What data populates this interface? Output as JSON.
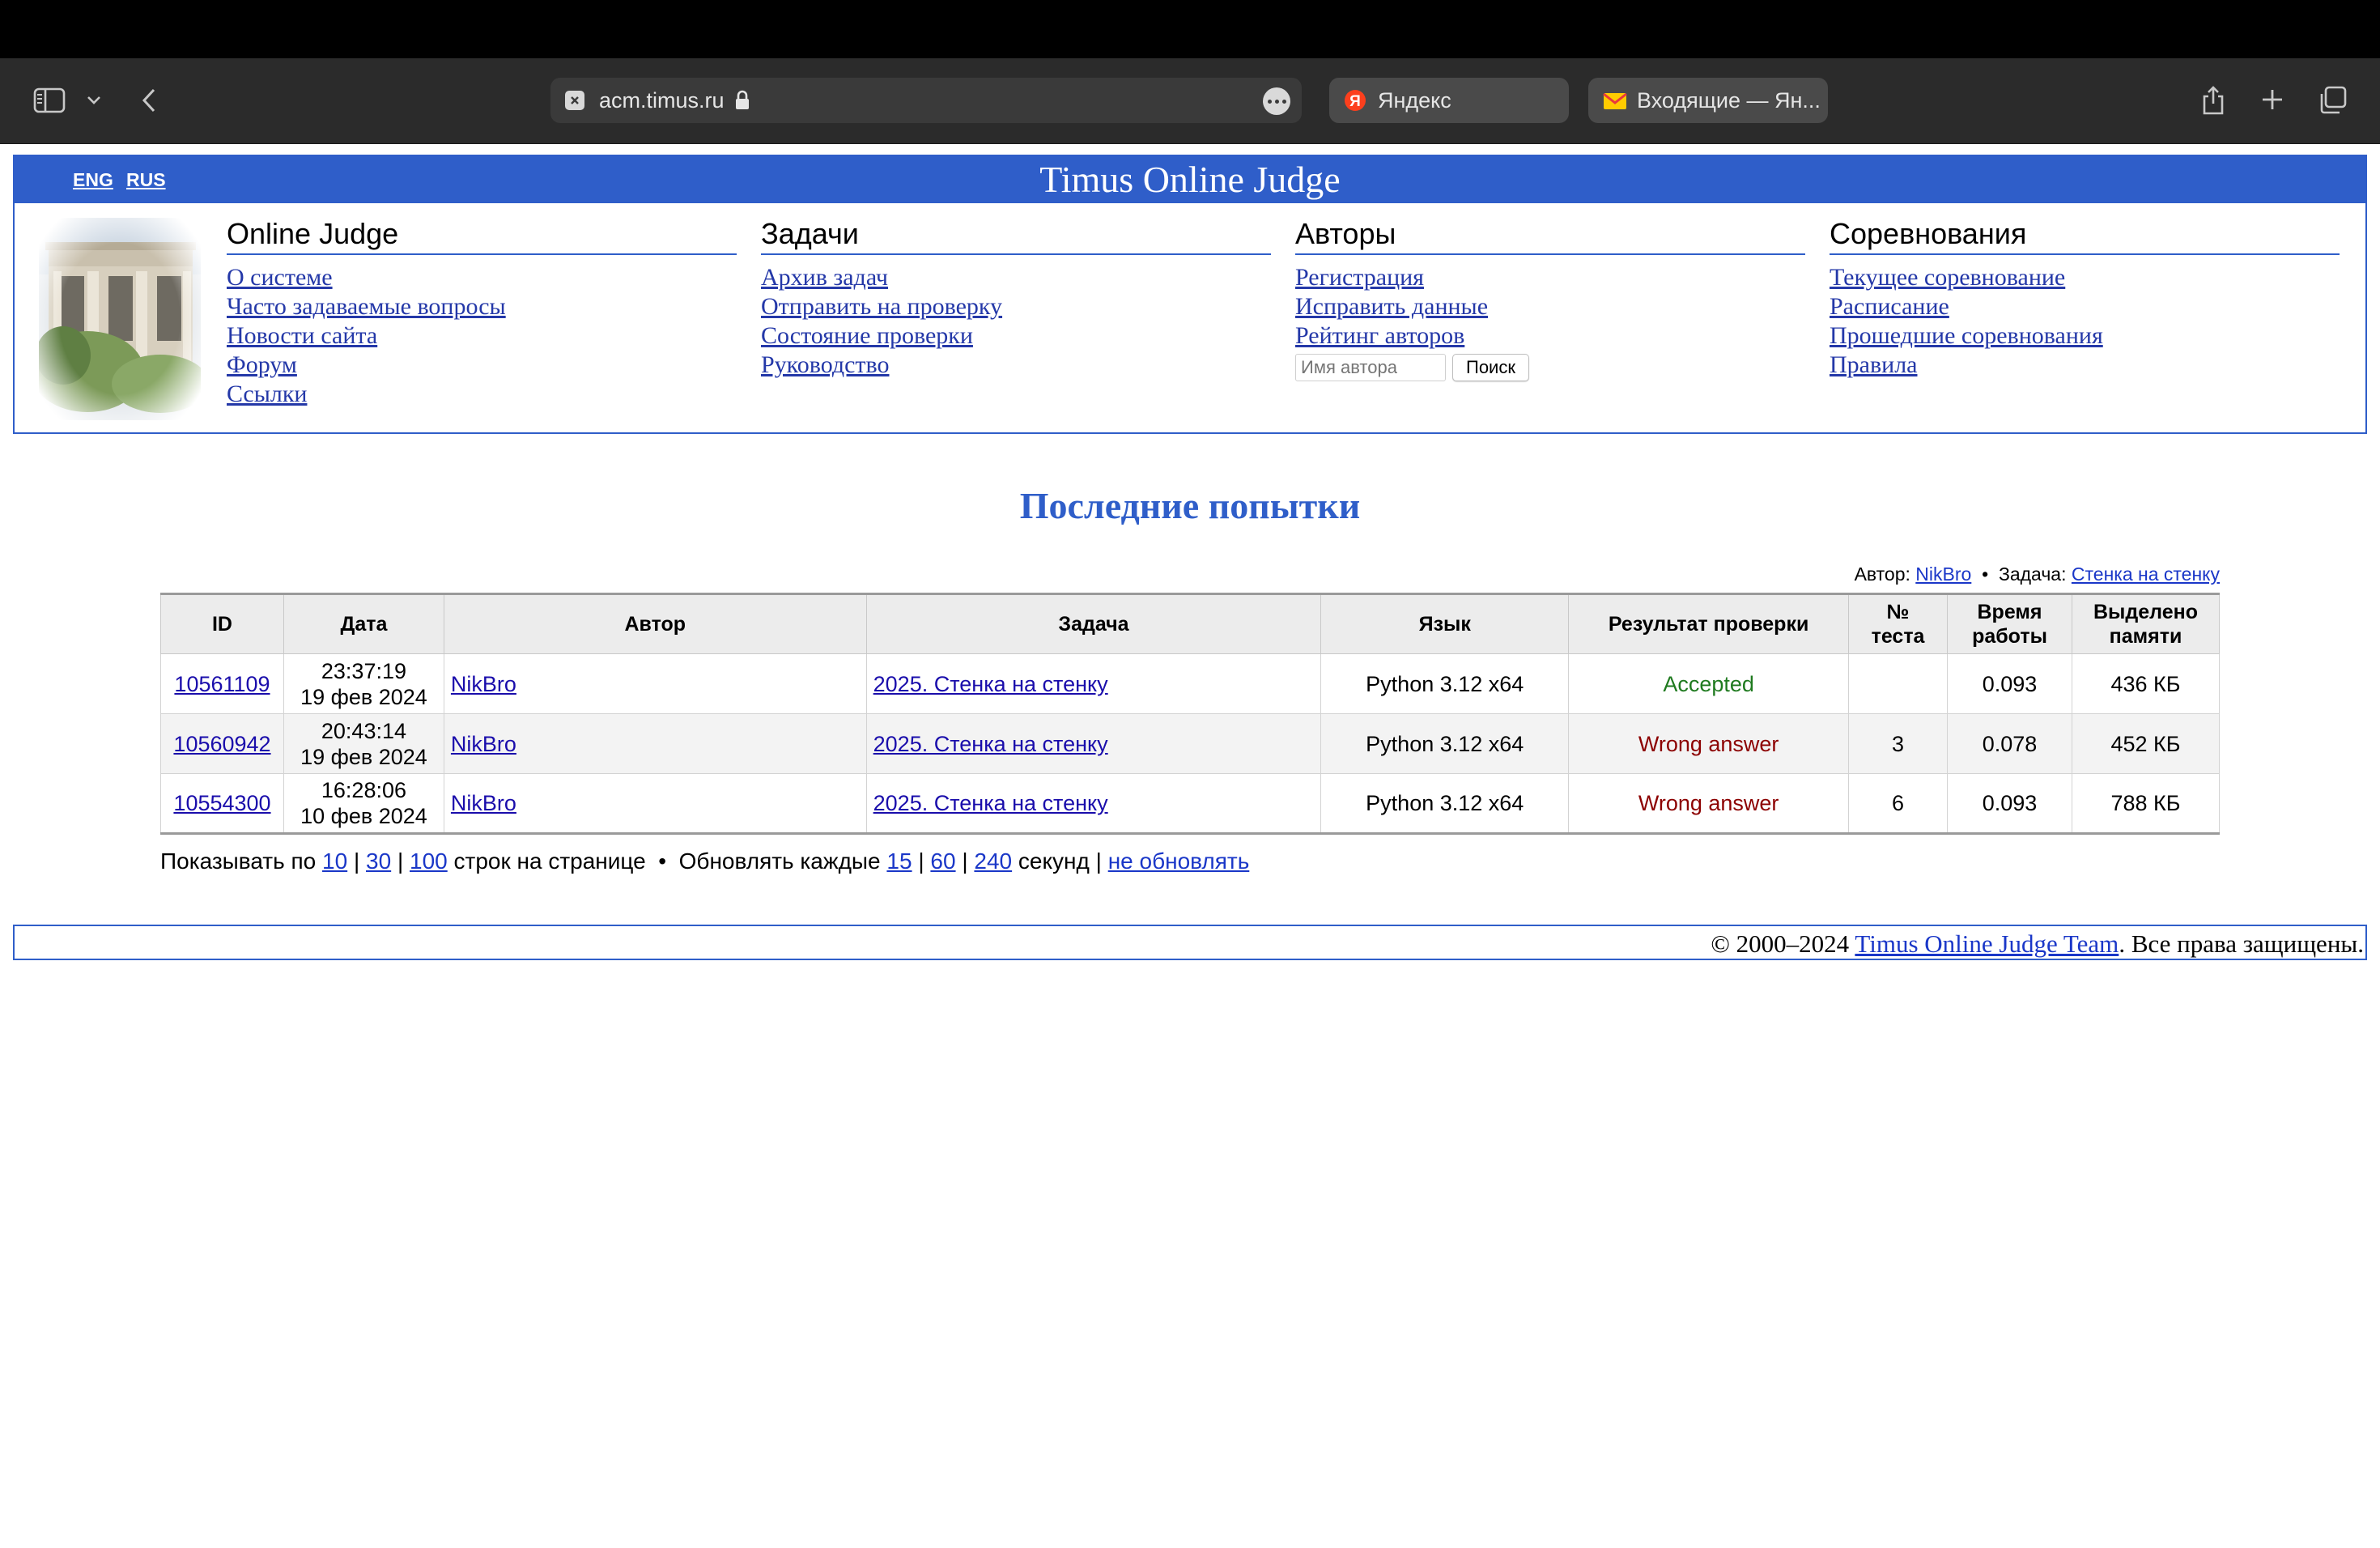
{
  "browser": {
    "url": "acm.timus.ru",
    "tabs": [
      {
        "title": "Яндекс",
        "icon": "yandex-icon"
      },
      {
        "title": "Входящие — Ян...",
        "icon": "mail-icon"
      }
    ]
  },
  "header": {
    "lang_eng": "ENG",
    "lang_rus": "RUS",
    "site_title": "Timus Online Judge"
  },
  "menu": {
    "online_judge": {
      "title": "Online Judge",
      "links": [
        "О системе",
        "Часто задаваемые вопросы",
        "Новости сайта",
        "Форум",
        "Ссылки"
      ]
    },
    "problems": {
      "title": "Задачи",
      "links": [
        "Архив задач",
        "Отправить на проверку",
        "Состояние проверки",
        "Руководство"
      ]
    },
    "authors": {
      "title": "Авторы",
      "links": [
        "Регистрация",
        "Исправить данные",
        "Рейтинг авторов"
      ],
      "search_placeholder": "Имя автора",
      "search_button": "Поиск"
    },
    "contests": {
      "title": "Соревнования",
      "links": [
        "Текущее соревнование",
        "Расписание",
        "Прошедшие соревнования",
        "Правила"
      ]
    }
  },
  "main": {
    "heading": "Последние попытки",
    "filter": {
      "author_label": "Автор:",
      "author": "NikBro",
      "sep": "•",
      "problem_label": "Задача:",
      "problem": "Стенка на стенку"
    },
    "columns": {
      "id": "ID",
      "date": "Дата",
      "author": "Автор",
      "problem": "Задача",
      "language": "Язык",
      "verdict": "Результат проверки",
      "test_l1": "№",
      "test_l2": "теста",
      "time_l1": "Время",
      "time_l2": "работы",
      "mem_l1": "Выделено",
      "mem_l2": "памяти"
    },
    "rows": [
      {
        "id": "10561109",
        "time": "23:37:19",
        "date": "19 фев 2024",
        "author": "NikBro",
        "problem": "2025. Стенка на стенку",
        "language": "Python 3.12 x64",
        "verdict": "Accepted",
        "test": "",
        "run_time": "0.093",
        "memory": "436 КБ"
      },
      {
        "id": "10560942",
        "time": "20:43:14",
        "date": "19 фев 2024",
        "author": "NikBro",
        "problem": "2025. Стенка на стенку",
        "language": "Python 3.12 x64",
        "verdict": "Wrong answer",
        "test": "3",
        "run_time": "0.078",
        "memory": "452 КБ"
      },
      {
        "id": "10554300",
        "time": "16:28:06",
        "date": "10 фев 2024",
        "author": "NikBro",
        "problem": "2025. Стенка на стенку",
        "language": "Python 3.12 x64",
        "verdict": "Wrong answer",
        "test": "6",
        "run_time": "0.093",
        "memory": "788 КБ"
      }
    ],
    "pager": {
      "show_label": "Показывать по",
      "page_sizes": [
        "10",
        "30",
        "100"
      ],
      "rows_label": "строк на странице",
      "bullet": "•",
      "refresh_label": "Обновлять каждые",
      "refresh_options": [
        "15",
        "60",
        "240"
      ],
      "seconds_label": "секунд",
      "no_refresh": "не обновлять",
      "pipe": "|"
    }
  },
  "footer": {
    "copyright": "© 2000–2024",
    "team": "Timus Online Judge Team",
    "rights": ". Все права защищены."
  },
  "colors": {
    "brand_blue": "#2f5ec9",
    "link": "#1a37c8",
    "accepted": "#1f7a1f",
    "wrong_answer": "#8c0000"
  }
}
